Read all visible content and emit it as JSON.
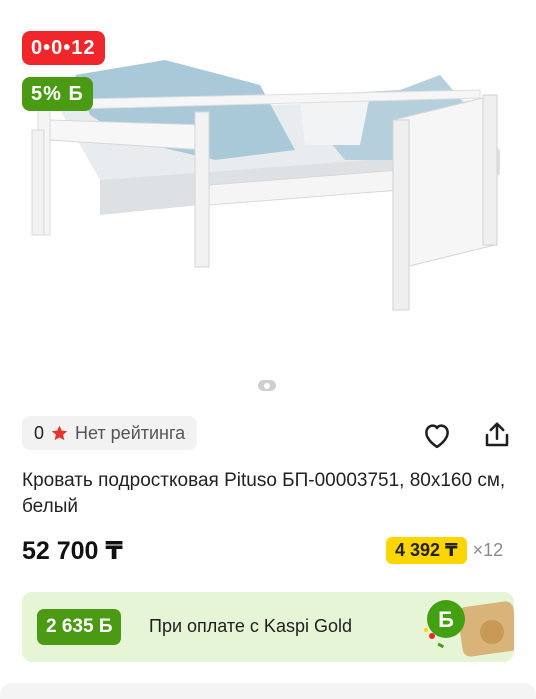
{
  "badges": {
    "installment": "0•0•12",
    "bonus": "5% Б"
  },
  "rating": {
    "count": "0",
    "label": "Нет рейтинга",
    "star_icon": "star-icon"
  },
  "actions": {
    "favorite_icon": "heart-icon",
    "share_icon": "share-icon"
  },
  "product": {
    "title": "Кровать подростковая Pituso БП-00003751, 80x160 см, белый",
    "price": "52 700 ₸"
  },
  "installment": {
    "monthly": "4 392 ₸",
    "term": "×12"
  },
  "kaspi_gold": {
    "bonus": "2 635 Б",
    "text": "При оплате с Kaspi Gold"
  },
  "colors": {
    "red": "#f0262a",
    "green": "#4a9a14",
    "yellow": "#ffd500",
    "banner_bg": "#e6f5d5"
  }
}
